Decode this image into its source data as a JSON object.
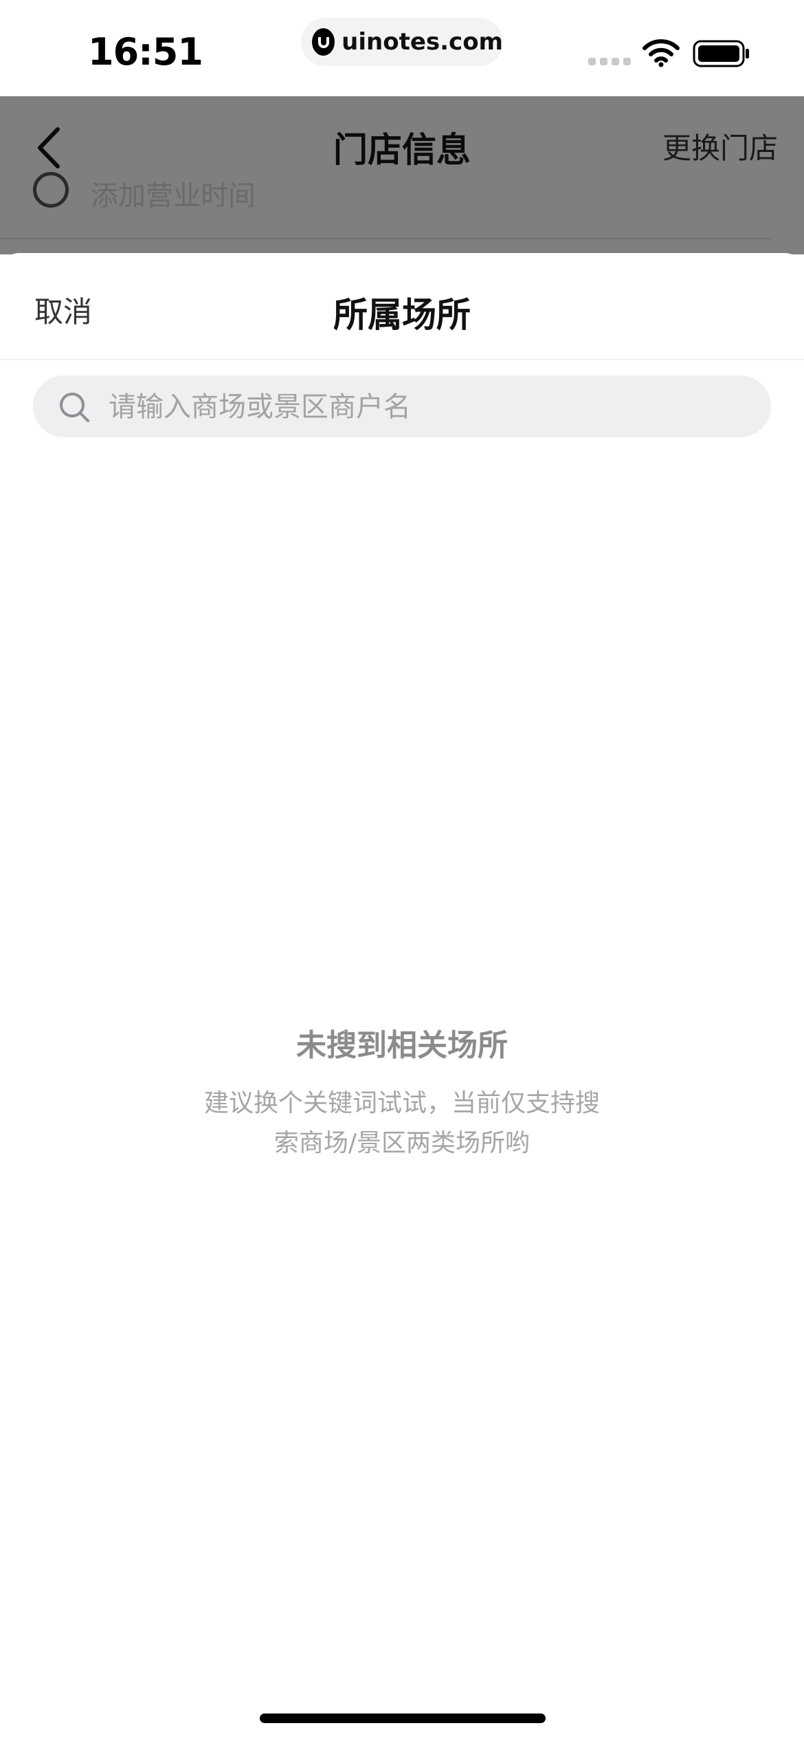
{
  "status_bar": {
    "time": "16:51",
    "url": "uinotes.com"
  },
  "background_page": {
    "title": "门店信息",
    "right_action": "更换门店",
    "row_text": "添加营业时间"
  },
  "sheet": {
    "cancel_label": "取消",
    "title": "所属场所",
    "search_placeholder": "请输入商场或景区商户名",
    "search_value": ""
  },
  "empty_state": {
    "title": "未搜到相关场所",
    "description": "建议换个关键词试试，当前仅支持搜索商场/景区两类场所哟"
  },
  "icons": [
    "back-chevron-icon",
    "search-icon",
    "wifi-icon",
    "battery-icon",
    "clock-icon",
    "uinotes-logo-icon"
  ],
  "colors": {
    "overlay": "#7f7f7f",
    "search_bg": "#efeff2",
    "muted_text": "#a6a6a6"
  }
}
